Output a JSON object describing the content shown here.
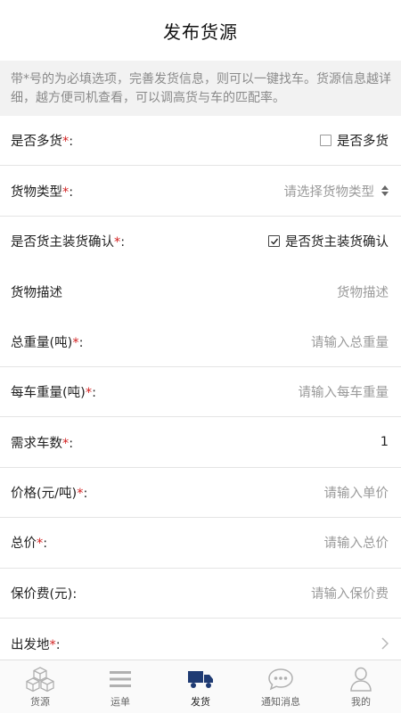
{
  "header": {
    "title": "发布货源"
  },
  "notice": "带*号的为必填选项，完善发货信息，则可以一键找车。货源信息越详细，越方便司机查看，可以调高货与车的匹配率。",
  "form": {
    "multi_goods": {
      "label": "是否多货",
      "checkbox_label": "是否多货",
      "checked": false
    },
    "goods_type": {
      "label": "货物类型",
      "placeholder": "请选择货物类型"
    },
    "owner_confirm": {
      "label": "是否货主装货确认",
      "checkbox_label": "是否货主装货确认",
      "checked": true
    },
    "goods_desc": {
      "label": "货物描述",
      "placeholder": "货物描述"
    },
    "total_weight": {
      "label": "总重量(吨)",
      "placeholder": "请输入总重量"
    },
    "weight_per_truck": {
      "label": "每车重量(吨)",
      "placeholder": "请输入每车重量"
    },
    "truck_count": {
      "label": "需求车数",
      "value": "1"
    },
    "price": {
      "label": "价格(元/吨)",
      "placeholder": "请输入单价"
    },
    "total_price": {
      "label": "总价",
      "placeholder": "请输入总价"
    },
    "insurance": {
      "label": "保价费(元)",
      "placeholder": "请输入保价费"
    },
    "origin": {
      "label": "出发地"
    }
  },
  "required_mark": "*",
  "colon": ":",
  "tabs": [
    {
      "label": "货源",
      "icon": "cubes-icon",
      "active": false
    },
    {
      "label": "运单",
      "icon": "list-icon",
      "active": false
    },
    {
      "label": "发货",
      "icon": "truck-icon",
      "active": true
    },
    {
      "label": "通知消息",
      "icon": "chat-bubble-icon",
      "active": false
    },
    {
      "label": "我的",
      "icon": "user-icon",
      "active": false
    }
  ],
  "colors": {
    "required": "#d21f1f",
    "active_tab": "#1f3b73",
    "placeholder": "#9a9a9a"
  }
}
